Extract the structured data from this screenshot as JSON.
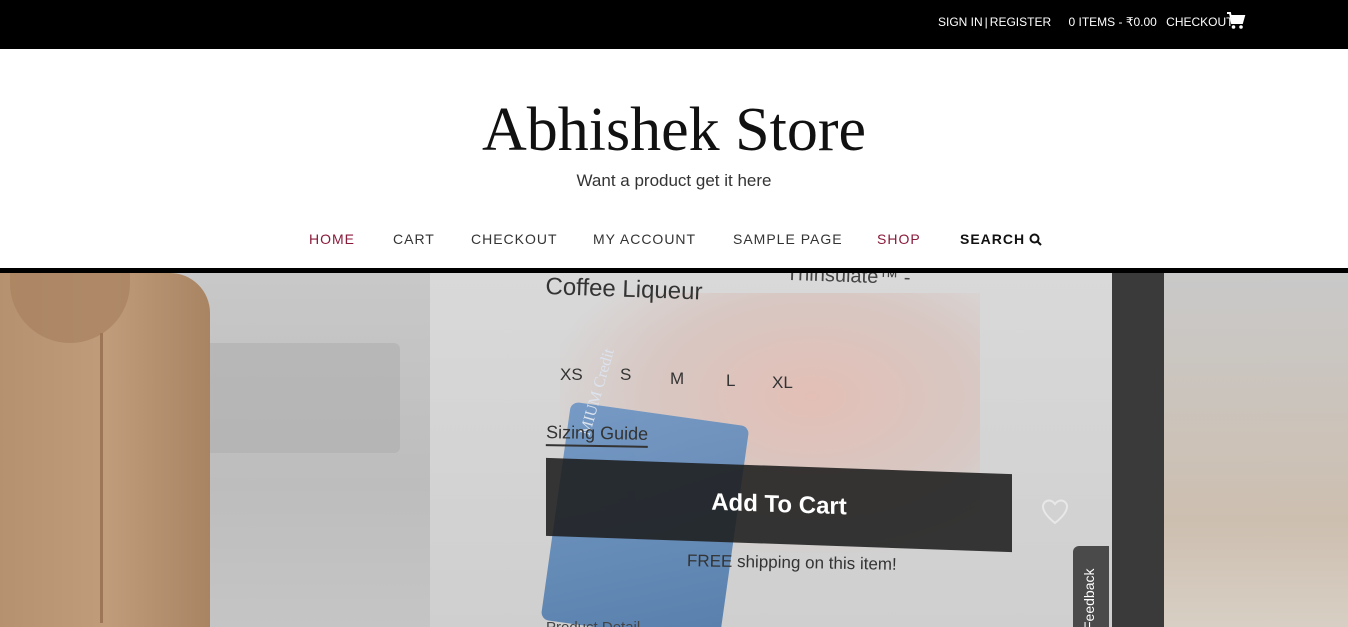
{
  "topbar": {
    "sign_in": "SIGN IN",
    "separator": "|",
    "register": "REGISTER",
    "cart_info": "0 ITEMS - ₹0.00",
    "checkout": "CHECKOUT",
    "cart_icon": "shopping-cart-icon"
  },
  "header": {
    "site_title": "Abhishek Store",
    "tagline": "Want a product get it here"
  },
  "nav": {
    "items": [
      {
        "label": "HOME",
        "active": true
      },
      {
        "label": "CART",
        "active": false
      },
      {
        "label": "CHECKOUT",
        "active": false
      },
      {
        "label": "MY ACCOUNT",
        "active": false
      },
      {
        "label": "SAMPLE PAGE",
        "active": false
      },
      {
        "label": "SHOP",
        "active": true
      }
    ],
    "search_label": "SEARCH",
    "search_icon": "search-icon"
  },
  "hero": {
    "product_title_top": "Thinsulate™ -",
    "product_title": "Coffee Liqueur",
    "card_text": "MIUM Credit",
    "sizes": [
      "XS",
      "S",
      "M",
      "L",
      "XL"
    ],
    "sizing_guide": "Sizing Guide",
    "add_to_cart": "Add To Cart",
    "free_shipping": "FREE shipping on this item!",
    "product_details": "Product Detail",
    "feedback": "Feedback",
    "wishlist_icon": "heart-icon"
  },
  "colors": {
    "topbar_bg": "#000000",
    "accent": "#8a1a3a",
    "text": "#333333"
  }
}
